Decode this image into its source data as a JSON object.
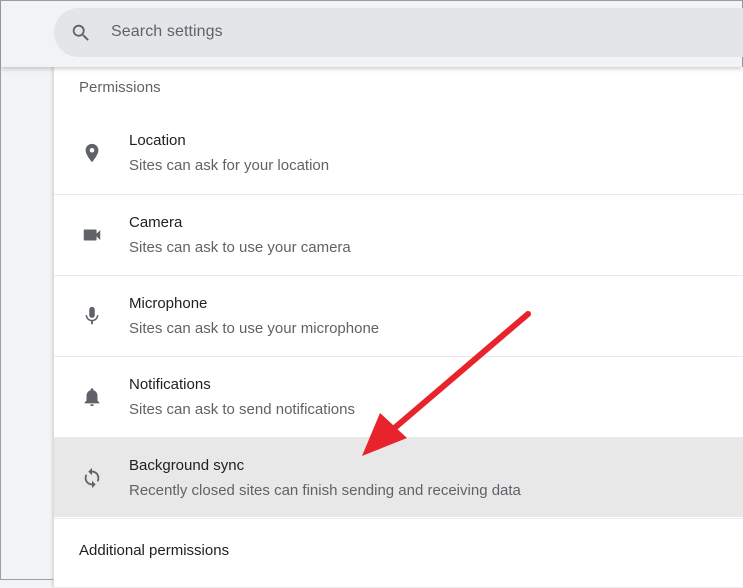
{
  "search": {
    "placeholder": "Search settings",
    "icon": "search-icon"
  },
  "permissions": {
    "title": "Permissions",
    "items": [
      {
        "title": "Location",
        "subtitle": "Sites can ask for your location",
        "icon": "location-pin-icon"
      },
      {
        "title": "Camera",
        "subtitle": "Sites can ask to use your camera",
        "icon": "camera-icon"
      },
      {
        "title": "Microphone",
        "subtitle": "Sites can ask to use your microphone",
        "icon": "microphone-icon"
      },
      {
        "title": "Notifications",
        "subtitle": "Sites can ask to send notifications",
        "icon": "bell-icon"
      },
      {
        "title": "Background sync",
        "subtitle": "Recently closed sites can finish sending and receiving data",
        "icon": "sync-icon",
        "highlighted": true
      }
    ]
  },
  "additional": {
    "title": "Additional permissions"
  },
  "annotation": {
    "arrow_color": "#e8232b"
  },
  "colors": {
    "icon": "#5f6368",
    "highlight_bg": "#e8e8e8"
  }
}
